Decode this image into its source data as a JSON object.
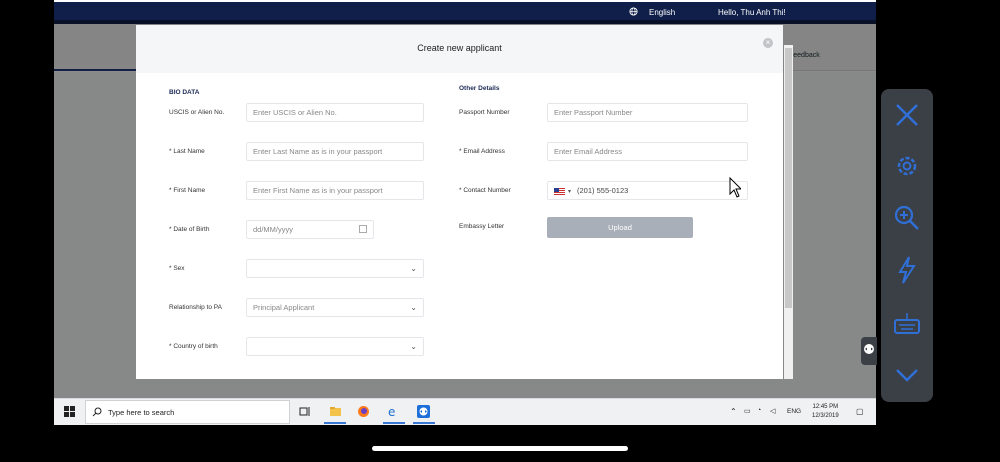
{
  "navbar": {
    "language": "English",
    "greeting": "Hello, Thu Anh Thi!"
  },
  "subbar": {
    "feedback": "Feedback"
  },
  "modal": {
    "title": "Create new applicant",
    "bio_heading": "BIO DATA",
    "other_heading": "Other Details",
    "fields": {
      "uscis": {
        "label": "USCIS or Alien No.",
        "placeholder": "Enter USCIS or Alien No."
      },
      "last_name": {
        "label": "* Last Name",
        "placeholder": "Enter Last Name as is in your passport"
      },
      "first_name": {
        "label": "* First Name",
        "placeholder": "Enter First Name as is in your passport"
      },
      "dob": {
        "label": "* Date of Birth",
        "placeholder": "dd/MM/yyyy"
      },
      "sex": {
        "label": "* Sex",
        "value": ""
      },
      "relationship": {
        "label": "Relationship to PA",
        "value": "Principal Applicant"
      },
      "country": {
        "label": "* Country of birth",
        "value": ""
      },
      "passport": {
        "label": "Passport Number",
        "placeholder": "Enter Passport Number"
      },
      "email": {
        "label": "* Email Address",
        "placeholder": "Enter Email Address"
      },
      "contact": {
        "label": "* Contact Number",
        "value": "(201) 555-0123"
      },
      "embassy": {
        "label": "Embassy Letter",
        "button": "Upload"
      }
    }
  },
  "taskbar": {
    "search_placeholder": "Type here to search",
    "language": "ENG",
    "time": "12:45 PM",
    "date": "12/3/2019"
  },
  "colors": {
    "navy": "#0f1f4a",
    "accent": "#223a7a",
    "upload": "#a9afb8"
  }
}
